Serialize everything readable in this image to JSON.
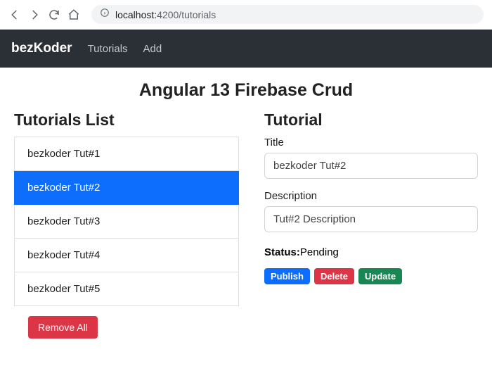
{
  "browser": {
    "url_host": "localhost:",
    "url_port_path": "4200/tutorials"
  },
  "navbar": {
    "brand": "bezKoder",
    "links": [
      "Tutorials",
      "Add"
    ]
  },
  "page_title": "Angular 13 Firebase Crud",
  "list": {
    "heading": "Tutorials List",
    "items": [
      {
        "label": "bezkoder Tut#1",
        "active": false
      },
      {
        "label": "bezkoder Tut#2",
        "active": true
      },
      {
        "label": "bezkoder Tut#3",
        "active": false
      },
      {
        "label": "bezkoder Tut#4",
        "active": false
      },
      {
        "label": "bezkoder Tut#5",
        "active": false
      }
    ],
    "remove_all_label": "Remove All"
  },
  "detail": {
    "heading": "Tutorial",
    "title_label": "Title",
    "title_value": "bezkoder Tut#2",
    "desc_label": "Description",
    "desc_value": "Tut#2 Description",
    "status_label": "Status:",
    "status_value": "Pending",
    "publish_label": "Publish",
    "delete_label": "Delete",
    "update_label": "Update"
  }
}
